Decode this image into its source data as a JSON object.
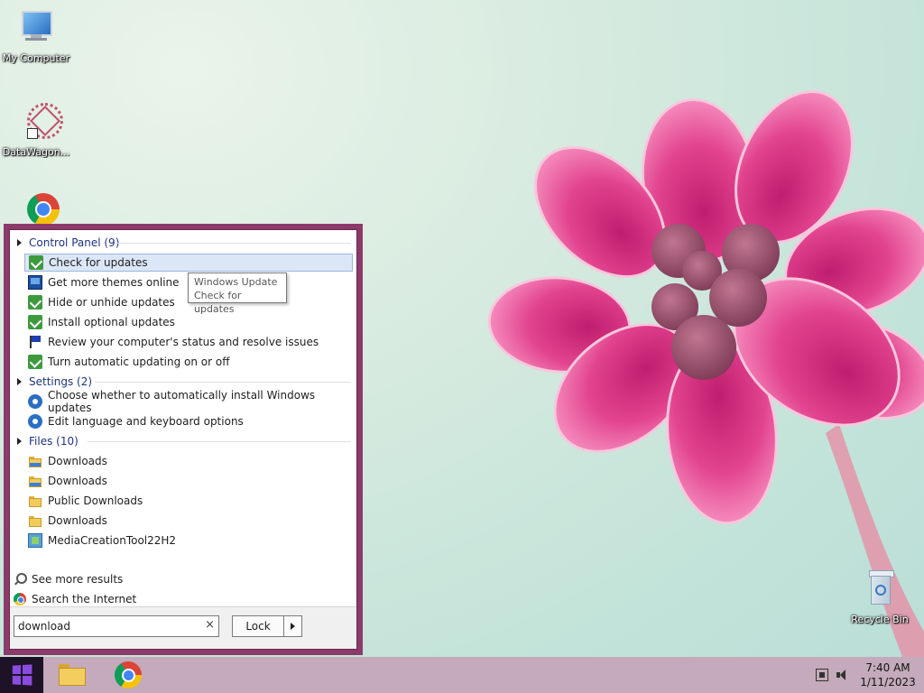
{
  "desktop": {
    "icons": [
      {
        "label": "My Computer"
      },
      {
        "label": "DataWagon..."
      },
      {
        "label": "Recycle Bin"
      }
    ]
  },
  "start_menu": {
    "groups": [
      {
        "header": "Control Panel (9)",
        "items": [
          {
            "label": "Check for updates",
            "icon": "windows-update-icon",
            "selected": true
          },
          {
            "label": "Get more themes online",
            "icon": "monitor-icon"
          },
          {
            "label": "Hide or unhide updates",
            "icon": "windows-update-icon"
          },
          {
            "label": "Install optional updates",
            "icon": "windows-update-icon"
          },
          {
            "label": "Review your computer's status and resolve issues",
            "icon": "action-center-flag-icon"
          },
          {
            "label": "Turn automatic updating on or off",
            "icon": "windows-update-icon"
          }
        ]
      },
      {
        "header": "Settings (2)",
        "items": [
          {
            "label": "Choose whether to automatically install Windows updates",
            "icon": "gear-icon"
          },
          {
            "label": "Edit language and keyboard options",
            "icon": "gear-icon"
          }
        ]
      },
      {
        "header": "Files (10)",
        "items": [
          {
            "label": "Downloads",
            "icon": "downloads-folder-icon"
          },
          {
            "label": "Downloads",
            "icon": "downloads-folder-icon"
          },
          {
            "label": "Public Downloads",
            "icon": "folder-icon"
          },
          {
            "label": "Downloads",
            "icon": "folder-icon"
          },
          {
            "label": "MediaCreationTool22H2",
            "icon": "installer-icon"
          }
        ]
      }
    ],
    "see_more": "See more results",
    "search_internet": "Search the Internet",
    "search": {
      "value": "download",
      "clear": "×"
    },
    "lock_button": "Lock"
  },
  "tooltip": {
    "line1": "Windows Update",
    "line2": "Check for updates"
  },
  "taskbar": {
    "time": "7:40 AM",
    "date": "1/11/2023"
  },
  "colors": {
    "start_menu_frame": "#8c3a69",
    "taskbar": "#c4aaba",
    "selection": "#dbe7f7",
    "group_header_text": "#1e3287"
  }
}
